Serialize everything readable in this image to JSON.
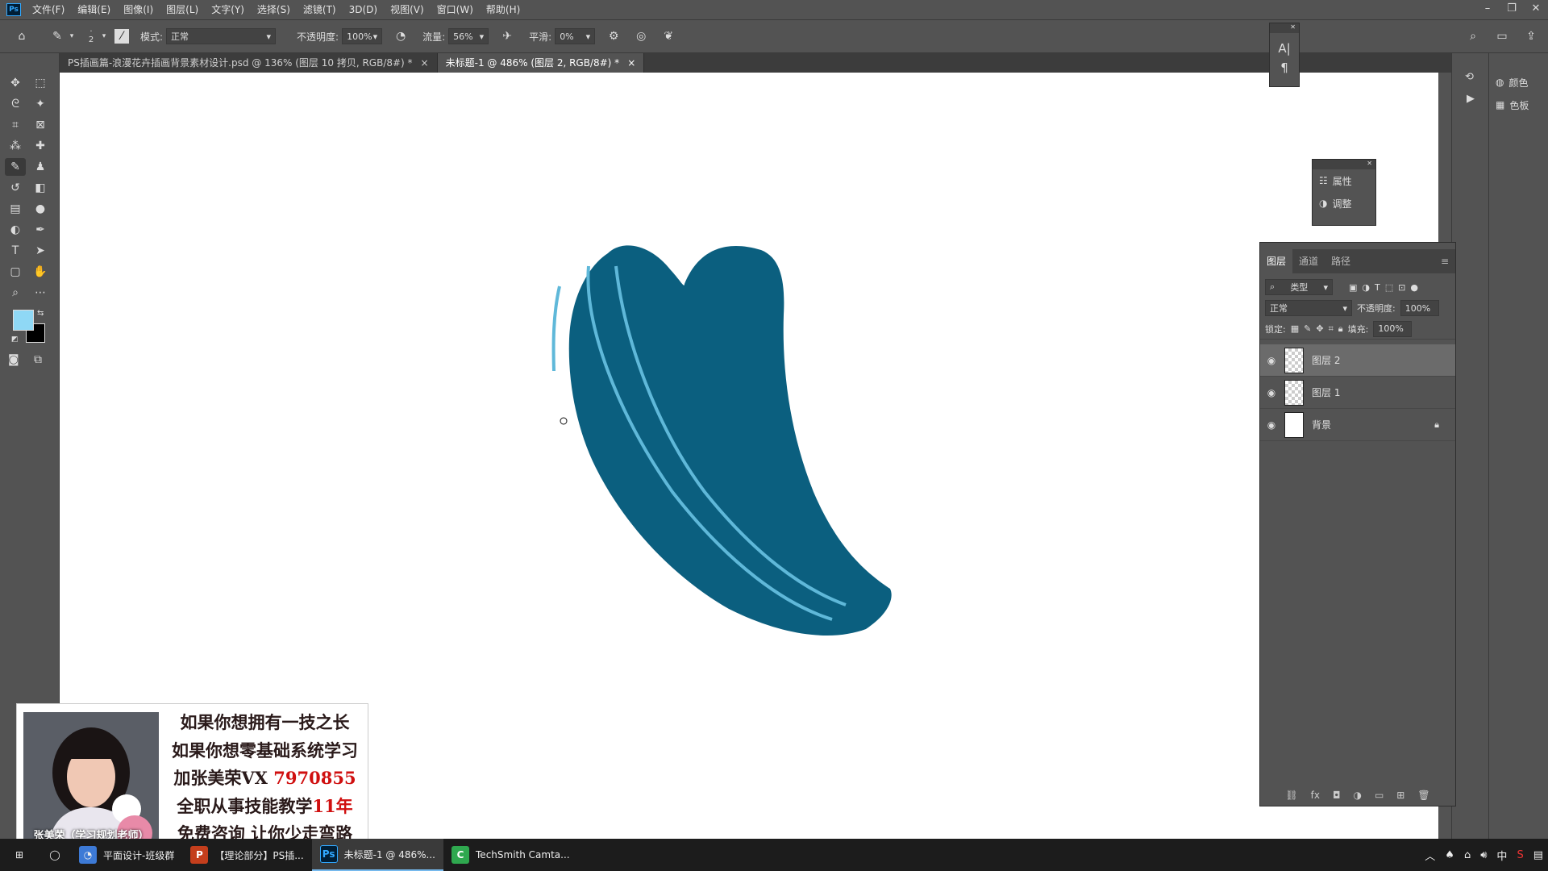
{
  "app": {
    "logo": "Ps"
  },
  "menu": {
    "items": [
      "文件(F)",
      "编辑(E)",
      "图像(I)",
      "图层(L)",
      "文字(Y)",
      "选择(S)",
      "滤镜(T)",
      "3D(D)",
      "视图(V)",
      "窗口(W)",
      "帮助(H)"
    ]
  },
  "window_controls": [
    "minimize-icon",
    "restore-icon",
    "close-icon"
  ],
  "options": {
    "brush_size": "2",
    "mode_label": "模式:",
    "mode_value": "正常",
    "opacity_label": "不透明度:",
    "opacity_value": "100%",
    "flow_label": "流量:",
    "flow_value": "56%",
    "smooth_label": "平滑:",
    "smooth_value": "0%"
  },
  "tabs": [
    {
      "label": "PS插画篇-浪漫花卉插画背景素材设计.psd @ 136% (图层 10 拷贝, RGB/8#) *",
      "close": "×"
    },
    {
      "label": "未标题-1 @ 486% (图层 2, RGB/8#) *",
      "close": "×"
    }
  ],
  "colors": {
    "foreground": "#8fd8f5",
    "background": "#000000",
    "leaf": "#0b5f7f",
    "leaf_highlight": "#5fb8d9"
  },
  "right_dock": {
    "items": [
      {
        "icon": "color-icon",
        "label": "颜色"
      },
      {
        "icon": "swatches-icon",
        "label": "色板"
      }
    ]
  },
  "properties_panel": {
    "items": [
      {
        "icon": "properties-icon",
        "label": "属性"
      },
      {
        "icon": "adjustments-icon",
        "label": "调整"
      }
    ]
  },
  "layers_panel": {
    "tabs": [
      "图层",
      "通道",
      "路径"
    ],
    "filter_value": "类型",
    "blend_value": "正常",
    "opacity_label": "不透明度:",
    "opacity_value": "100%",
    "lock_label": "锁定:",
    "fill_label": "填充:",
    "fill_value": "100%",
    "layers": [
      {
        "name": "图层 2",
        "selected": true
      },
      {
        "name": "图层 1",
        "selected": false
      },
      {
        "name": "背景",
        "selected": false,
        "locked": true
      }
    ],
    "footer_icons": [
      "link-icon",
      "fx-icon",
      "mask-icon",
      "adjustment-icon",
      "folder-icon",
      "new-layer-icon",
      "trash-icon"
    ]
  },
  "promo": {
    "lines": [
      "如果你想拥有一技之长",
      "如果你想零基础系统学习",
      "加张美荣VX ",
      "全职从事技能教学",
      "免费咨询 让你少走弯路"
    ],
    "vx_number": "7970855",
    "years": "11年",
    "caption": "张美荣（学习规划老师）"
  },
  "taskbar": {
    "items": [
      {
        "label": "平面设计-班级群",
        "active": false
      },
      {
        "label": "【理论部分】PS插...",
        "active": false
      },
      {
        "label": "未标题-1 @ 486%...",
        "active": true
      },
      {
        "label": "TechSmith Camta...",
        "active": false
      }
    ],
    "tray_ime": "中"
  }
}
